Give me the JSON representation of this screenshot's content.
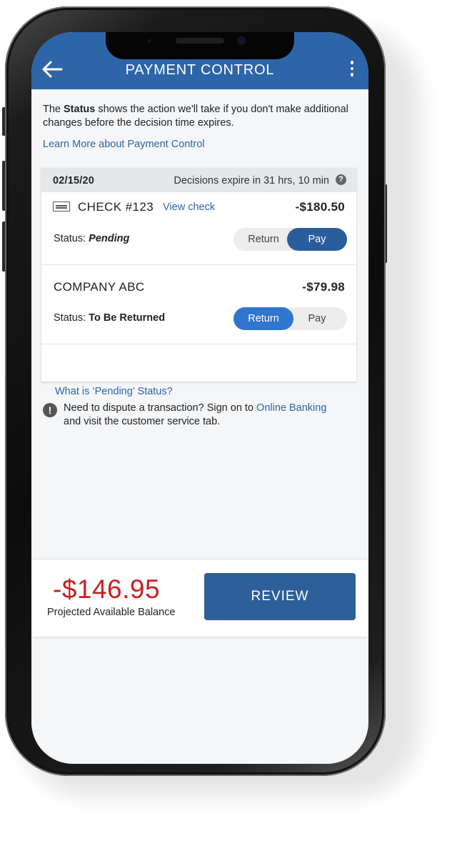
{
  "header": {
    "title": "PAYMENT CONTROL",
    "back_icon": "back-arrow-icon",
    "menu_icon": "kebab-menu-icon"
  },
  "intro": {
    "prefix": "The ",
    "bold": "Status",
    "suffix": " shows the action we'll take if you don't make additional changes before the decision time expires."
  },
  "learn_more": "Learn More about Payment Control",
  "card": {
    "date": "02/15/20",
    "expire_text": "Decisions expire in 31 hrs, 10 min",
    "help_icon": "?",
    "transactions": [
      {
        "name": "CHECK #123",
        "link": "View check",
        "amount": "-$180.50",
        "status_label": "Status: ",
        "status_value": "Pending",
        "options": [
          "Return",
          "Pay"
        ],
        "selected": "Pay"
      },
      {
        "name": "COMPANY ABC",
        "amount": "-$79.98",
        "status_label": "Status: ",
        "status_value": "To Be Returned",
        "options": [
          "Return",
          "Pay"
        ],
        "selected": "Return"
      }
    ],
    "pending_question": "What is ‘Pending’ Status?"
  },
  "notice": {
    "icon": "!",
    "text": "Need to dispute a transaction? Sign on to ",
    "link": "Online Banking",
    "suffix": " and visit the customer service tab."
  },
  "footer": {
    "balance": "-$146.95",
    "balance_label": "Projected Available Balance",
    "review_label": "REVIEW"
  },
  "colors": {
    "header": "#2d65a8",
    "link": "#2d65a8",
    "negative": "#c8201f",
    "toggle_blue": "#2f76cc",
    "review": "#2d5f99"
  }
}
